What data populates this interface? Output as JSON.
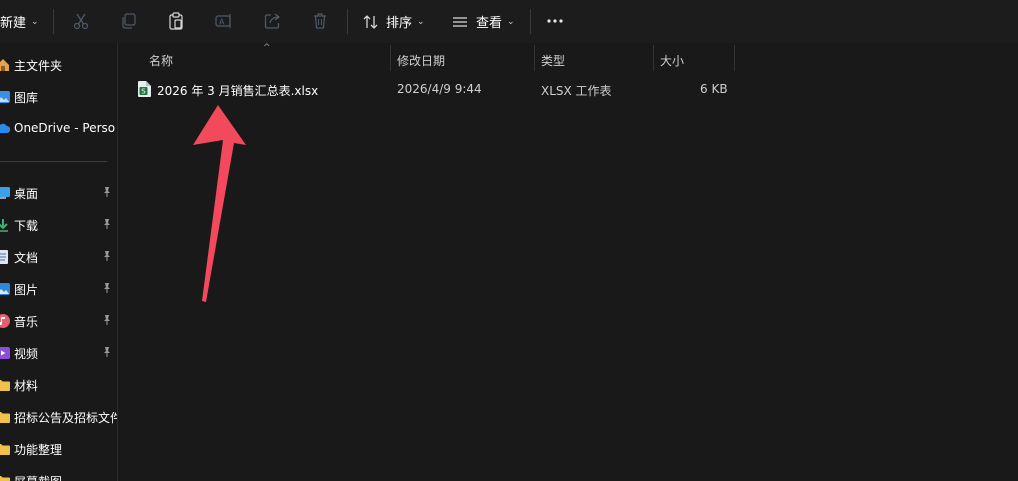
{
  "toolbar": {
    "new_label": "新建",
    "sort_label": "排序",
    "view_label": "查看",
    "icons": [
      "scissors-icon",
      "copy-icon",
      "paste-icon",
      "rename-icon",
      "share-icon",
      "delete-icon",
      "sort-icon",
      "view-icon",
      "more-icon"
    ]
  },
  "sidebar": {
    "items": [
      {
        "label": "主文件夹",
        "icon": "home-icon"
      },
      {
        "label": "图库",
        "icon": "gallery-icon"
      },
      {
        "label": "OneDrive - Perso",
        "icon": "cloud-icon"
      },
      {
        "label": "桌面",
        "icon": "desktop-icon",
        "pinned": true
      },
      {
        "label": "下载",
        "icon": "download-icon",
        "pinned": true
      },
      {
        "label": "文档",
        "icon": "document-icon",
        "pinned": true
      },
      {
        "label": "图片",
        "icon": "pictures-icon",
        "pinned": true
      },
      {
        "label": "音乐",
        "icon": "music-icon",
        "pinned": true
      },
      {
        "label": "视频",
        "icon": "video-icon",
        "pinned": true
      },
      {
        "label": "材料",
        "icon": "folder-icon"
      },
      {
        "label": "招标公告及招标文件",
        "icon": "folder-icon"
      },
      {
        "label": "功能整理",
        "icon": "folder-icon"
      },
      {
        "label": "屏幕截图",
        "icon": "folder-icon"
      }
    ]
  },
  "columns": {
    "name": "名称",
    "modified": "修改日期",
    "type": "类型",
    "size": "大小"
  },
  "files": [
    {
      "name": "2026 年 3 月销售汇总表.xlsx",
      "modified": "2026/4/9 9:44",
      "type": "XLSX 工作表",
      "size": "6 KB",
      "icon": "spreadsheet-icon"
    }
  ],
  "colors": {
    "background": "#191919",
    "toolbar": "#1c1c1c",
    "annotation_arrow": "#f2495c",
    "excel_green": "#1d7a45"
  }
}
